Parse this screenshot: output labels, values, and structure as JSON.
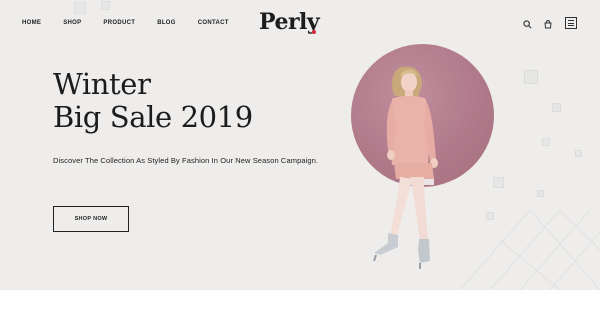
{
  "nav": {
    "items": [
      "HOME",
      "SHOP",
      "PRODUCT",
      "BLOG",
      "CONTACT"
    ]
  },
  "brand": {
    "logo": "Perly",
    "accent": "#d1293f"
  },
  "header_icons": [
    "search-icon",
    "bag-icon",
    "menu-icon"
  ],
  "hero": {
    "title_line1": "Winter",
    "title_line2": "Big Sale 2019",
    "subtitle": "Discover The Collection As Styled By Fashion In Our New Season Campaign.",
    "button_label": "SHOP NOW",
    "circle_color": "#b07a8b",
    "background": "#eeedec"
  }
}
